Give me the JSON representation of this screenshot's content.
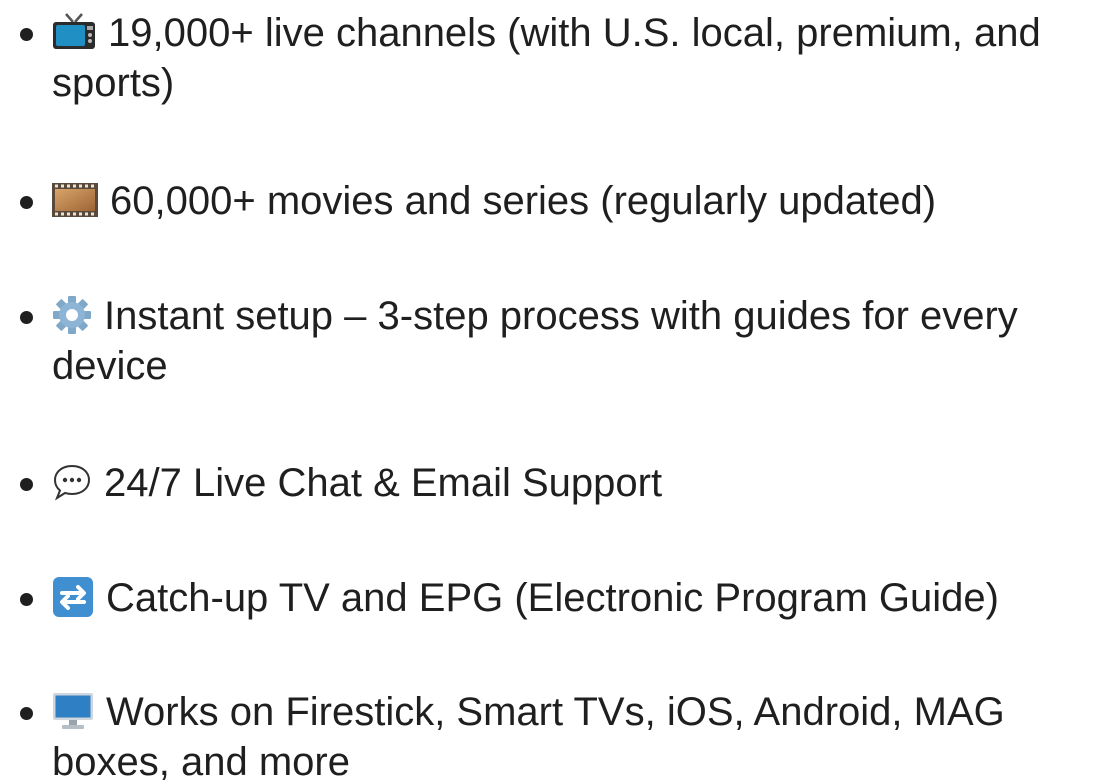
{
  "features": [
    {
      "icon": "television-icon",
      "text": "19,000+ live channels (with U.S. local, premium, and sports)"
    },
    {
      "icon": "film-frames-icon",
      "text": "60,000+ movies and series (regularly updated)"
    },
    {
      "icon": "gear-icon",
      "text": "Instant setup – 3-step process with guides for every device"
    },
    {
      "icon": "speech-balloon-icon",
      "text": "24/7 Live Chat & Email Support"
    },
    {
      "icon": "counterclockwise-arrows-icon",
      "text": "Catch-up TV and EPG (Electronic Program Guide)"
    },
    {
      "icon": "desktop-computer-icon",
      "text": "Works on Firestick, Smart TVs, iOS, Android, MAG boxes, and more"
    }
  ],
  "colors": {
    "text": "#1f1f1f",
    "background": "#ffffff"
  }
}
